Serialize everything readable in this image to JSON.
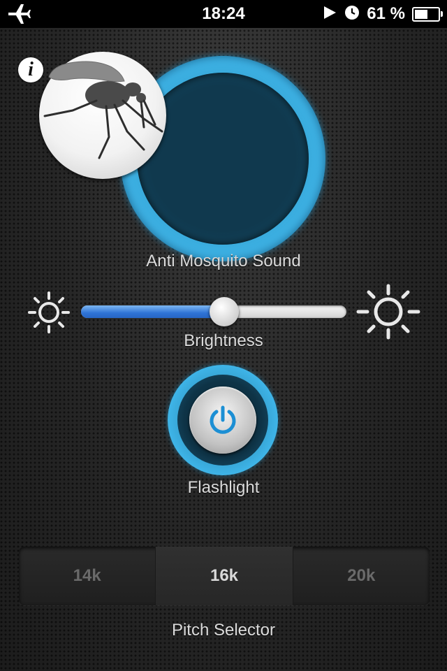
{
  "status_bar": {
    "time": "18:24",
    "battery_percent": "61 %",
    "battery_level": 0.61,
    "icons": [
      "airplane-icon",
      "location-icon",
      "clock-icon",
      "battery-icon"
    ]
  },
  "info_button": {
    "icon": "info-icon",
    "label": "i"
  },
  "mosquito": {
    "label": "Anti Mosquito Sound",
    "icon": "mosquito-icon",
    "accent": "#3fb6ea"
  },
  "brightness": {
    "label": "Brightness",
    "value": 0.54,
    "fill_color": "#2f73d6"
  },
  "flashlight": {
    "label": "Flashlight",
    "icon": "power-icon",
    "icon_color": "#1c8fd4"
  },
  "pitch": {
    "label": "Pitch Selector",
    "options": [
      "14k",
      "16k",
      "20k"
    ],
    "selected": "16k"
  }
}
